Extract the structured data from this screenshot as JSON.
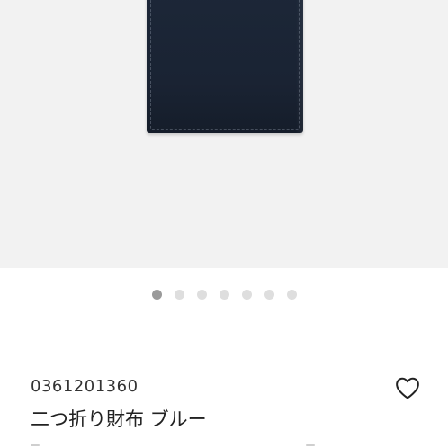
{
  "gallery": {
    "image_alt": "wallet-photo",
    "slide_count": 7,
    "active_slide": 1,
    "colors": {
      "background": "#f2f2f2",
      "wallet": "#1a2333",
      "dot_active": "#9a9a9a",
      "dot_inactive": "#dedede"
    }
  },
  "product": {
    "sku": "0361201360",
    "title": "二つ折り財布 ブルー",
    "favorite_icon": "heart-outline-icon"
  }
}
